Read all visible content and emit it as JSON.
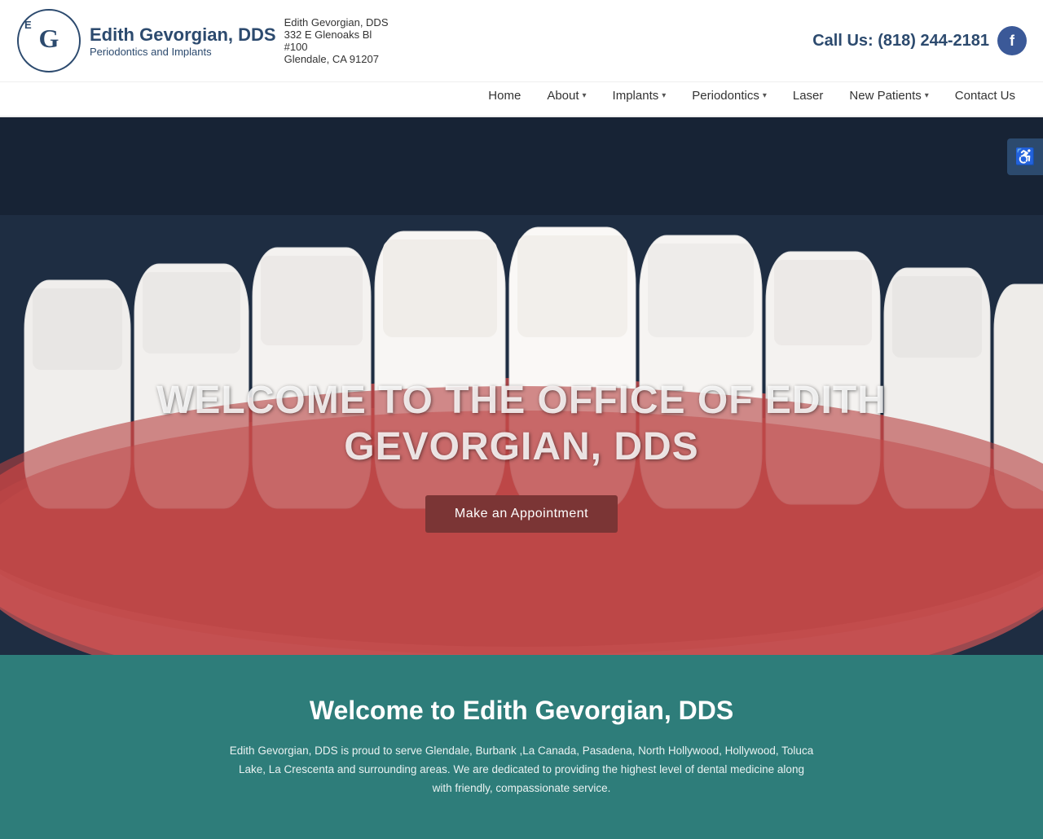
{
  "header": {
    "logo_name": "Edith Gevorgian, DDS",
    "logo_subtitle": "Periodontics and Implants",
    "address_line1": "Edith Gevorgian, DDS",
    "address_line2": "332 E Glenoaks Bl",
    "address_line3": "#100",
    "address_line4": "Glendale, CA 91207",
    "call_label": "Call Us: (818) 244-2181",
    "fb_label": "f"
  },
  "nav": {
    "items": [
      {
        "label": "Home",
        "has_dropdown": false
      },
      {
        "label": "About",
        "has_dropdown": true
      },
      {
        "label": "Implants",
        "has_dropdown": true
      },
      {
        "label": "Periodontics",
        "has_dropdown": true
      },
      {
        "label": "Laser",
        "has_dropdown": false
      },
      {
        "label": "New Patients",
        "has_dropdown": true
      },
      {
        "label": "Contact Us",
        "has_dropdown": false
      }
    ]
  },
  "hero": {
    "title_line1": "WELCOME TO THE OFFICE OF EDITH",
    "title_line2": "GEVORGIAN, DDS",
    "appointment_button": "Make an Appointment"
  },
  "accessibility": {
    "label": "♿"
  },
  "welcome": {
    "heading": "Welcome to Edith Gevorgian, DDS",
    "body": "Edith Gevorgian, DDS is proud to serve Glendale, Burbank ,La Canada, Pasadena, North Hollywood, Hollywood, Toluca Lake, La Crescenta and surrounding areas. We are dedicated to providing the highest level of dental medicine along with friendly, compassionate service."
  }
}
